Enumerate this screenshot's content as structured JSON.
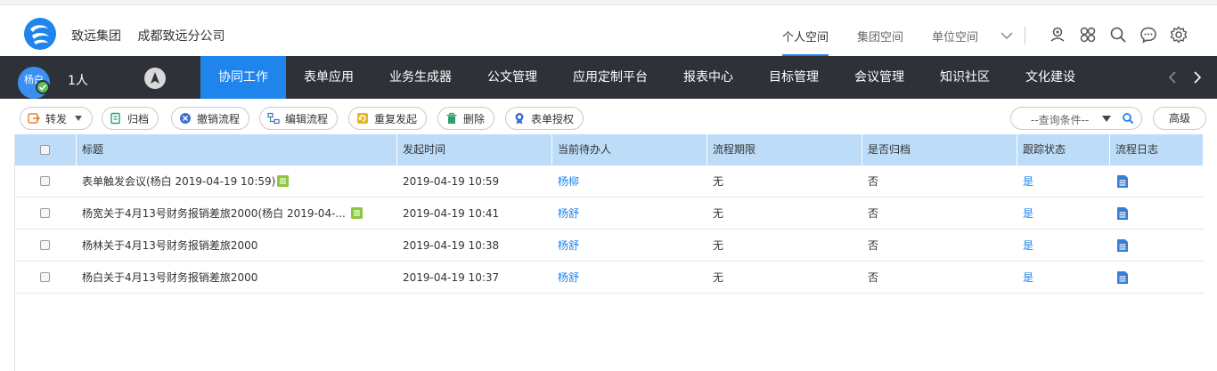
{
  "header": {
    "org_name": "致远集团",
    "branch_name": "成都致远分公司",
    "spaces": [
      {
        "label": "个人空间",
        "active": true
      },
      {
        "label": "集团空间",
        "active": false
      },
      {
        "label": "单位空间",
        "active": false
      }
    ],
    "icons": [
      "location-icon",
      "apps-icon",
      "search-icon",
      "message-icon",
      "settings-icon"
    ]
  },
  "nav": {
    "avatar_text": "杨白",
    "user_count_label": "1人",
    "tabs": [
      {
        "label": "协同工作",
        "active": true
      },
      {
        "label": "表单应用"
      },
      {
        "label": "业务生成器"
      },
      {
        "label": "公文管理"
      },
      {
        "label": "应用定制平台"
      },
      {
        "label": "报表中心"
      },
      {
        "label": "目标管理"
      },
      {
        "label": "会议管理"
      },
      {
        "label": "知识社区"
      },
      {
        "label": "文化建设"
      }
    ]
  },
  "toolbar": {
    "forward_label": "转发",
    "archive_label": "归档",
    "revoke_label": "撤销流程",
    "edit_label": "编辑流程",
    "resend_label": "重复发起",
    "delete_label": "删除",
    "authorize_label": "表单授权",
    "query_placeholder": "--查询条件--",
    "advanced_label": "高级"
  },
  "table": {
    "columns": [
      "标题",
      "发起时间",
      "当前待办人",
      "流程期限",
      "是否归档",
      "跟踪状态",
      "流程日志"
    ],
    "rows": [
      {
        "title": "表单触发会议(杨白 2019-04-19 10:59)",
        "has_form": true,
        "time": "2019-04-19 10:59",
        "handler": "杨柳",
        "deadline": "无",
        "archived": "否",
        "tracking": "是"
      },
      {
        "title": "杨宽关于4月13号财务报销差旅2000(杨白 2019-04-...",
        "has_form": true,
        "time": "2019-04-19 10:41",
        "handler": "杨舒",
        "deadline": "无",
        "archived": "否",
        "tracking": "是"
      },
      {
        "title": "杨林关于4月13号财务报销差旅2000",
        "has_form": false,
        "time": "2019-04-19 10:38",
        "handler": "杨舒",
        "deadline": "无",
        "archived": "否",
        "tracking": "是"
      },
      {
        "title": "杨白关于4月13号财务报销差旅2000",
        "has_form": false,
        "time": "2019-04-19 10:37",
        "handler": "杨舒",
        "deadline": "无",
        "archived": "否",
        "tracking": "是"
      }
    ]
  },
  "colors": {
    "accent": "#1f85ec",
    "nav_bg": "#2e3238",
    "table_header_bg": "#bcdcf7",
    "form_icon": "#8cc63f"
  }
}
